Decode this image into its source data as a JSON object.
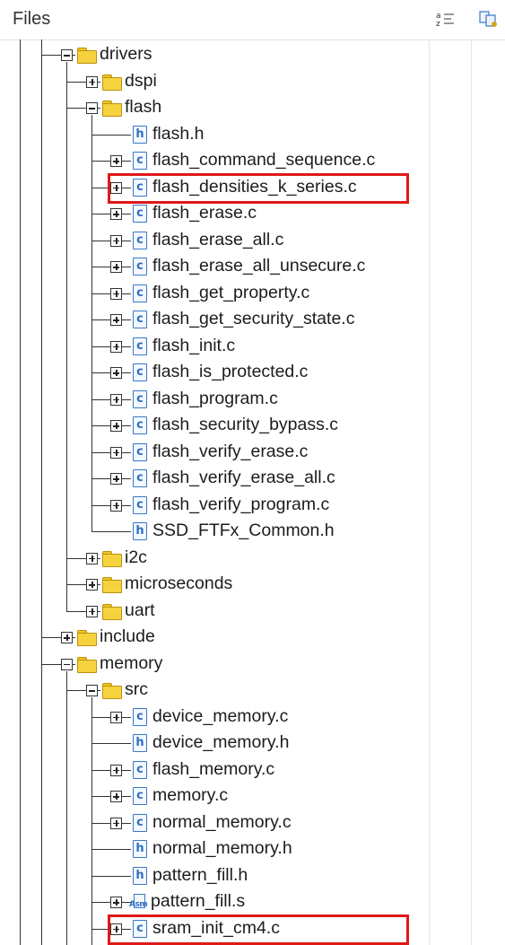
{
  "panel": {
    "title": "Files",
    "header_icons": [
      "sort-icon",
      "options-icon"
    ]
  },
  "tree": [
    {
      "name": "drivers",
      "kind": "folder",
      "level": 2,
      "expander": "minus"
    },
    {
      "name": "dspi",
      "kind": "folder",
      "level": 3,
      "expander": "plus"
    },
    {
      "name": "flash",
      "kind": "folder",
      "level": 3,
      "expander": "minus"
    },
    {
      "name": "flash.h",
      "kind": "h",
      "level": 4,
      "expander": "none"
    },
    {
      "name": "flash_command_sequence.c",
      "kind": "c",
      "level": 4,
      "expander": "plus"
    },
    {
      "name": "flash_densities_k_series.c",
      "kind": "c",
      "level": 4,
      "expander": "plus",
      "highlighted": true
    },
    {
      "name": "flash_erase.c",
      "kind": "c",
      "level": 4,
      "expander": "plus"
    },
    {
      "name": "flash_erase_all.c",
      "kind": "c",
      "level": 4,
      "expander": "plus"
    },
    {
      "name": "flash_erase_all_unsecure.c",
      "kind": "c",
      "level": 4,
      "expander": "plus"
    },
    {
      "name": "flash_get_property.c",
      "kind": "c",
      "level": 4,
      "expander": "plus"
    },
    {
      "name": "flash_get_security_state.c",
      "kind": "c",
      "level": 4,
      "expander": "plus"
    },
    {
      "name": "flash_init.c",
      "kind": "c",
      "level": 4,
      "expander": "plus"
    },
    {
      "name": "flash_is_protected.c",
      "kind": "c",
      "level": 4,
      "expander": "plus"
    },
    {
      "name": "flash_program.c",
      "kind": "c",
      "level": 4,
      "expander": "plus"
    },
    {
      "name": "flash_security_bypass.c",
      "kind": "c",
      "level": 4,
      "expander": "plus"
    },
    {
      "name": "flash_verify_erase.c",
      "kind": "c",
      "level": 4,
      "expander": "plus"
    },
    {
      "name": "flash_verify_erase_all.c",
      "kind": "c",
      "level": 4,
      "expander": "plus"
    },
    {
      "name": "flash_verify_program.c",
      "kind": "c",
      "level": 4,
      "expander": "plus"
    },
    {
      "name": "SSD_FTFx_Common.h",
      "kind": "h",
      "level": 4,
      "expander": "none",
      "last": true
    },
    {
      "name": "i2c",
      "kind": "folder",
      "level": 3,
      "expander": "plus"
    },
    {
      "name": "microseconds",
      "kind": "folder",
      "level": 3,
      "expander": "plus"
    },
    {
      "name": "uart",
      "kind": "folder",
      "level": 3,
      "expander": "plus",
      "last": true
    },
    {
      "name": "include",
      "kind": "folder",
      "level": 2,
      "expander": "plus"
    },
    {
      "name": "memory",
      "kind": "folder",
      "level": 2,
      "expander": "minus"
    },
    {
      "name": "src",
      "kind": "folder",
      "level": 3,
      "expander": "minus"
    },
    {
      "name": "device_memory.c",
      "kind": "c",
      "level": 4,
      "expander": "plus"
    },
    {
      "name": "device_memory.h",
      "kind": "h",
      "level": 4,
      "expander": "none"
    },
    {
      "name": "flash_memory.c",
      "kind": "c",
      "level": 4,
      "expander": "plus"
    },
    {
      "name": "memory.c",
      "kind": "c",
      "level": 4,
      "expander": "plus"
    },
    {
      "name": "normal_memory.c",
      "kind": "c",
      "level": 4,
      "expander": "plus"
    },
    {
      "name": "normal_memory.h",
      "kind": "h",
      "level": 4,
      "expander": "none"
    },
    {
      "name": "pattern_fill.h",
      "kind": "h",
      "level": 4,
      "expander": "none"
    },
    {
      "name": "pattern_fill.s",
      "kind": "asm",
      "level": 4,
      "expander": "plus"
    },
    {
      "name": "sram_init_cm4.c",
      "kind": "c",
      "level": 4,
      "expander": "plus",
      "highlighted": true
    }
  ],
  "colors": {
    "highlight": "#e01818",
    "file_icon": "#3a78c8",
    "folder_icon": "#f7d23f"
  }
}
